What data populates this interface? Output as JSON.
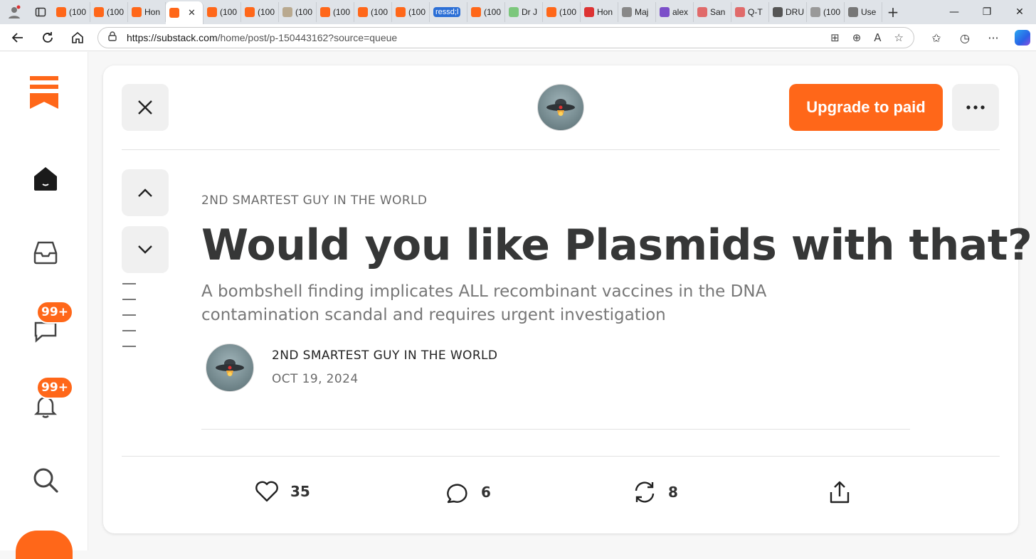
{
  "browser": {
    "tabs": [
      {
        "label": "(100",
        "icon": "substack-icon",
        "color": "#ff6719"
      },
      {
        "label": "(100",
        "icon": "substack-icon",
        "color": "#ff6719"
      },
      {
        "label": "Hon",
        "icon": "substack-icon",
        "color": "#ff6719"
      },
      {
        "label": "",
        "icon": "substack-icon",
        "color": "#ff6719",
        "active": true
      },
      {
        "label": "(100",
        "icon": "substack-icon",
        "color": "#ff6719"
      },
      {
        "label": "(100",
        "icon": "substack-icon",
        "color": "#ff6719"
      },
      {
        "label": "(100",
        "icon": "image-icon",
        "color": "#b9a98f"
      },
      {
        "label": "(100",
        "icon": "substack-icon",
        "color": "#ff6719"
      },
      {
        "label": "(100",
        "icon": "substack-icon",
        "color": "#ff6719"
      },
      {
        "label": "(100",
        "icon": "substack-icon",
        "color": "#ff6719"
      },
      {
        "label": "ressd;l",
        "icon": "none",
        "color": "#2b6fd6",
        "pill": true
      },
      {
        "label": "(100",
        "icon": "substack-icon",
        "color": "#ff6719"
      },
      {
        "label": "Dr J",
        "icon": "play-icon",
        "color": "#7cc77c"
      },
      {
        "label": "(100",
        "icon": "substack-icon",
        "color": "#ff6719"
      },
      {
        "label": "Hon",
        "icon": "pin-icon",
        "color": "#d33"
      },
      {
        "label": "Maj",
        "icon": "search-icon",
        "color": "#888"
      },
      {
        "label": "alex",
        "icon": "yahoo-icon",
        "color": "#7b4fc9"
      },
      {
        "label": "San",
        "icon": "youtube-icon",
        "color": "#e06a6a"
      },
      {
        "label": "Q-T",
        "icon": "youtube-icon",
        "color": "#e06a6a"
      },
      {
        "label": "DRU",
        "icon": "stripes-icon",
        "color": "#555"
      },
      {
        "label": "(100",
        "icon": "image-icon",
        "color": "#999"
      },
      {
        "label": "Use",
        "icon": "pen-icon",
        "color": "#777"
      }
    ],
    "close_tab": "✕",
    "new_tab": "+",
    "url_host": "https://substack.com",
    "url_path": "/home/post/p-150443162?source=queue"
  },
  "rail": {
    "badges": {
      "inbox_chat": "99+",
      "notifications": "99+"
    }
  },
  "post": {
    "publication": "2ND SMARTEST GUY IN THE WORLD",
    "title": "Would you like Plasmids with that?",
    "subtitle": "A bombshell finding implicates ALL recombinant vaccines in the DNA contamination scandal and requires urgent investigation",
    "author": "2ND SMARTEST GUY IN THE WORLD",
    "date": "OCT 19, 2024",
    "upgrade_label": "Upgrade to paid",
    "likes": "35",
    "comments": "6",
    "restacks": "8"
  },
  "colors": {
    "accent": "#ff6719",
    "text": "#363737",
    "muted": "#777777"
  }
}
